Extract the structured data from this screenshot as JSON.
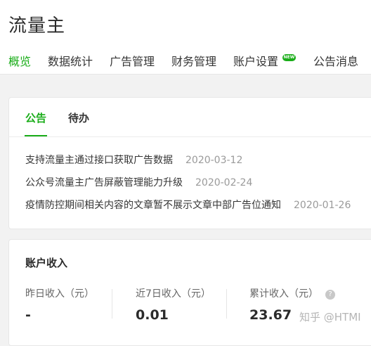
{
  "header": {
    "title": "流量主",
    "tabs": [
      {
        "label": "概览",
        "active": true
      },
      {
        "label": "数据统计"
      },
      {
        "label": "广告管理"
      },
      {
        "label": "财务管理"
      },
      {
        "label": "账户设置",
        "badge": "NEW"
      },
      {
        "label": "公告消息"
      }
    ]
  },
  "notice_card": {
    "tabs": [
      {
        "label": "公告",
        "active": true
      },
      {
        "label": "待办"
      }
    ],
    "items": [
      {
        "title": "支持流量主通过接口获取广告数据",
        "date": "2020-03-12"
      },
      {
        "title": "公众号流量主广告屏蔽管理能力升级",
        "date": "2020-02-24"
      },
      {
        "title": "疫情防控期间相关内容的文章暂不展示文章中部广告位通知",
        "date": "2020-01-26"
      }
    ]
  },
  "income_card": {
    "title": "账户收入",
    "stats": [
      {
        "label": "昨日收入（元）",
        "value": "-"
      },
      {
        "label": "近7日收入（元）",
        "value": "0.01"
      },
      {
        "label": "累计收入（元）",
        "value": "23.67",
        "help": "?"
      }
    ]
  },
  "watermark": "知乎 @HTMI",
  "colors": {
    "accent": "#1aad19",
    "background": "#f2f2f2"
  }
}
